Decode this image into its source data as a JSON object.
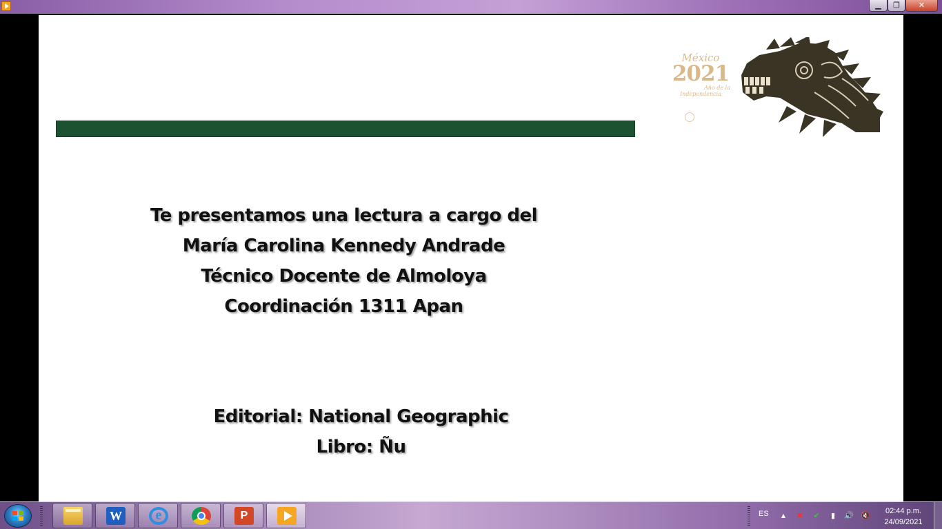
{
  "window": {
    "app_icon": "media-player-icon",
    "controls": {
      "minimize": "▁",
      "maximize": "❐",
      "close": "✕"
    }
  },
  "slide": {
    "logo": {
      "mexico": "México",
      "year": "2021",
      "subtitle_1": "Año de la",
      "subtitle_2": "Independencia"
    },
    "presenter_lines": [
      "Te presentamos una lectura a cargo del",
      "María Carolina Kennedy Andrade",
      "Técnico Docente de Almoloya",
      "Coordinación 1311 Apan"
    ],
    "book_lines": [
      "Editorial: National Geographic",
      "Libro: Ñu"
    ],
    "colors": {
      "green_bar": "#1d5230",
      "logo_gold": "#d9b98a",
      "serpent": "#3a3424"
    }
  },
  "taskbar": {
    "start_icon": "windows-start-icon",
    "apps": [
      {
        "name": "file-explorer-icon",
        "glyph": ""
      },
      {
        "name": "word-icon",
        "glyph": "W"
      },
      {
        "name": "internet-explorer-icon",
        "glyph": "e"
      },
      {
        "name": "chrome-icon",
        "glyph": ""
      },
      {
        "name": "powerpoint-icon",
        "glyph": "P"
      },
      {
        "name": "media-player-icon",
        "glyph": ""
      }
    ],
    "tray": {
      "language": "ES",
      "show_hidden": "▲",
      "network": "▮",
      "volume": "🔊",
      "time": "02:44 p.m.",
      "date": "24/09/2021"
    }
  }
}
